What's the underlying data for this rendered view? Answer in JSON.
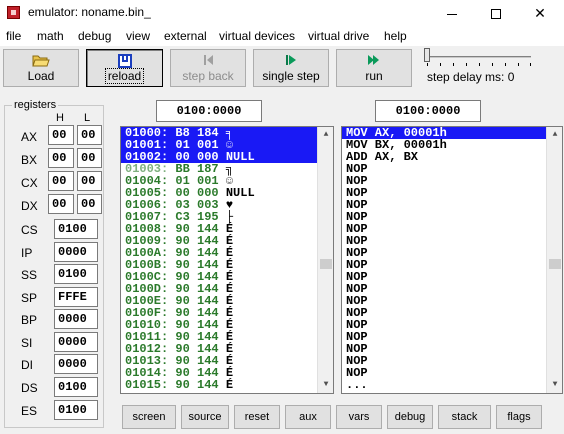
{
  "window": {
    "title": "emulator: noname.bin_"
  },
  "menu": [
    "file",
    "math",
    "debug",
    "view",
    "external",
    "virtual devices",
    "virtual drive",
    "help"
  ],
  "toolbar": {
    "load": "Load",
    "reload": "reload",
    "step_back": "step back",
    "single_step": "single step",
    "run": "run",
    "step_delay": "step delay ms: 0"
  },
  "addresses": {
    "memory": "0100:0000",
    "disasm": "0100:0000"
  },
  "registers": {
    "title": "registers",
    "h_label": "H",
    "l_label": "L",
    "general": [
      {
        "name": "AX",
        "h": "00",
        "l": "00"
      },
      {
        "name": "BX",
        "h": "00",
        "l": "00"
      },
      {
        "name": "CX",
        "h": "00",
        "l": "00"
      },
      {
        "name": "DX",
        "h": "00",
        "l": "00"
      }
    ],
    "segment": [
      {
        "name": "CS",
        "value": "0100"
      },
      {
        "name": "IP",
        "value": "0000"
      },
      {
        "name": "SS",
        "value": "0100"
      },
      {
        "name": "SP",
        "value": "FFFE"
      },
      {
        "name": "BP",
        "value": "0000"
      },
      {
        "name": "SI",
        "value": "0000"
      },
      {
        "name": "DI",
        "value": "0000"
      },
      {
        "name": "DS",
        "value": "0100"
      },
      {
        "name": "ES",
        "value": "0100"
      }
    ]
  },
  "memory_rows": [
    {
      "addr": "01000:",
      "hex": "B8",
      "dec": "184",
      "ch": "╕"
    },
    {
      "addr": "01001:",
      "hex": "01",
      "dec": "001",
      "ch": "☺"
    },
    {
      "addr": "01002:",
      "hex": "00",
      "dec": "000",
      "ch": "NULL"
    },
    {
      "addr": "01003:",
      "hex": "BB",
      "dec": "187",
      "ch": "╗"
    },
    {
      "addr": "01004:",
      "hex": "01",
      "dec": "001",
      "ch": "☺"
    },
    {
      "addr": "01005:",
      "hex": "00",
      "dec": "000",
      "ch": "NULL"
    },
    {
      "addr": "01006:",
      "hex": "03",
      "dec": "003",
      "ch": "♥"
    },
    {
      "addr": "01007:",
      "hex": "C3",
      "dec": "195",
      "ch": "├"
    },
    {
      "addr": "01008:",
      "hex": "90",
      "dec": "144",
      "ch": "É"
    },
    {
      "addr": "01009:",
      "hex": "90",
      "dec": "144",
      "ch": "É"
    },
    {
      "addr": "0100A:",
      "hex": "90",
      "dec": "144",
      "ch": "É"
    },
    {
      "addr": "0100B:",
      "hex": "90",
      "dec": "144",
      "ch": "É"
    },
    {
      "addr": "0100C:",
      "hex": "90",
      "dec": "144",
      "ch": "É"
    },
    {
      "addr": "0100D:",
      "hex": "90",
      "dec": "144",
      "ch": "É"
    },
    {
      "addr": "0100E:",
      "hex": "90",
      "dec": "144",
      "ch": "É"
    },
    {
      "addr": "0100F:",
      "hex": "90",
      "dec": "144",
      "ch": "É"
    },
    {
      "addr": "01010:",
      "hex": "90",
      "dec": "144",
      "ch": "É"
    },
    {
      "addr": "01011:",
      "hex": "90",
      "dec": "144",
      "ch": "É"
    },
    {
      "addr": "01012:",
      "hex": "90",
      "dec": "144",
      "ch": "É"
    },
    {
      "addr": "01013:",
      "hex": "90",
      "dec": "144",
      "ch": "É"
    },
    {
      "addr": "01014:",
      "hex": "90",
      "dec": "144",
      "ch": "É"
    },
    {
      "addr": "01015:",
      "hex": "90",
      "dec": "144",
      "ch": "É"
    }
  ],
  "disasm_rows": [
    "MOV AX, 00001h",
    "MOV BX, 00001h",
    "ADD AX, BX",
    "NOP",
    "NOP",
    "NOP",
    "NOP",
    "NOP",
    "NOP",
    "NOP",
    "NOP",
    "NOP",
    "NOP",
    "NOP",
    "NOP",
    "NOP",
    "NOP",
    "NOP",
    "NOP",
    "NOP",
    "NOP",
    "..."
  ],
  "bottom_buttons": [
    "screen",
    "source",
    "reset",
    "aux",
    "vars",
    "debug",
    "stack",
    "flags"
  ],
  "colors": {
    "selection": "#1919f5",
    "value_green": "#2b7a2b"
  }
}
